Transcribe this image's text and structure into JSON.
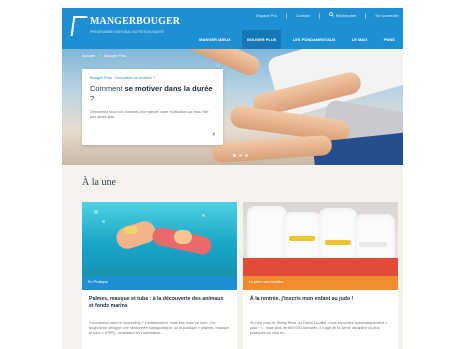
{
  "header": {
    "logo_text": "MANGERBOUGER",
    "logo_sub": "PROGRAMME NATIONAL NUTRITION SANTÉ",
    "utility": [
      {
        "label": "Espace Pro"
      },
      {
        "label": "Contact"
      },
      {
        "label": "Rechercher",
        "icon": "search-icon"
      },
      {
        "label": "Se connecter"
      }
    ],
    "nav": [
      {
        "label": "MANGER MIEUX",
        "active": false
      },
      {
        "label": "BOUGER PLUS",
        "active": true
      },
      {
        "label": "LES FONDAMENTAUX",
        "active": false
      },
      {
        "label": "LE MAG",
        "active": false
      },
      {
        "label": "PNNS",
        "active": false
      }
    ]
  },
  "hero": {
    "breadcrumb": [
      "Accueil",
      "Bouger Plus"
    ],
    "kicker": "Bouger Plus : Comment se motiver ?",
    "title_prefix": "Comment ",
    "title_bold": "se motiver dans la durée",
    "title_suffix": " ?",
    "description": "Découvrez tous nos conseils pour garder votre motivation au beau fixe jour après jour",
    "arrow": "›",
    "slides": 3,
    "active_slide": 1
  },
  "section": {
    "title": "À la une",
    "cards": [
      {
        "tag": "En Pratique",
        "title": "Palmes, masque et tuba : à la découverte des animaux et fonds marins",
        "description": "Connaissez-vous le snorkeling ? Certainement, mais pas sous ce nom. Cet anglicisme désigne une randonnée subaquatique, ou la pratique « palmes, masque et tuba » (PMT), consistant en l'admiration..."
      },
      {
        "tag": "Le plein des familles",
        "title": "À la rentrée, j'inscris mon enfant au judo !",
        "description": "Si c'est vous et Teddy Riner ou David Douillet, nous répondez automatiquement « judo ! » : mais plus de 600 000 licenciés, il s'agit de la 4ème discipline la plus pratiquée en club en..."
      }
    ]
  },
  "colors": {
    "brand_blue": "#1f8fd4",
    "nav_active": "#1577b6",
    "tag_orange": "#f08b2e",
    "section_bg": "#f6f2ee"
  }
}
